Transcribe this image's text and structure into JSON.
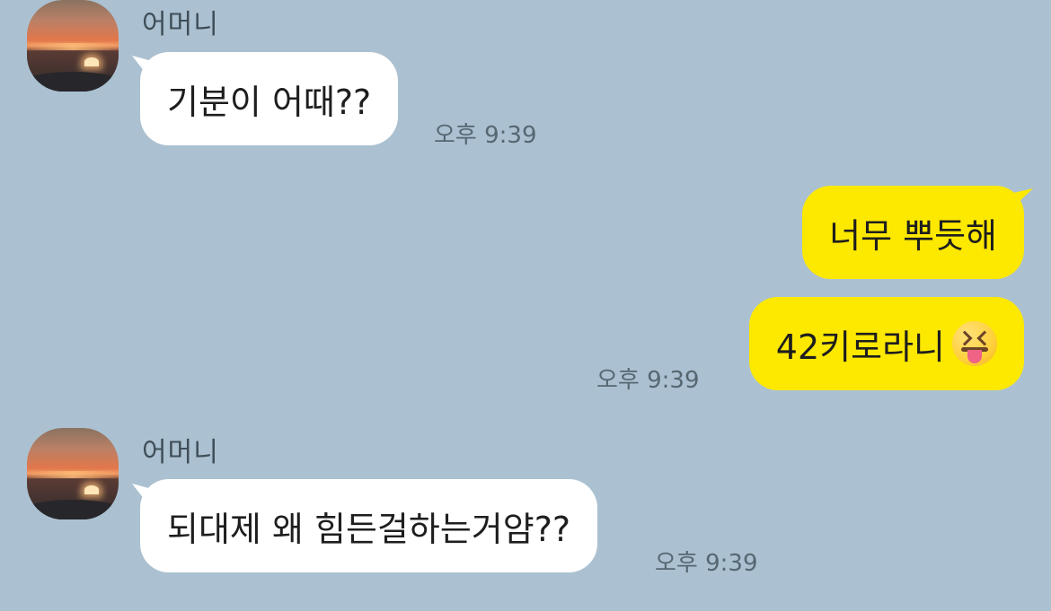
{
  "conversation": {
    "messages": [
      {
        "sender": "어머니",
        "text": "기분이 어때??",
        "time": "오후 9:39"
      },
      {
        "text": "너무 뿌듯해"
      },
      {
        "text": "42키로라니",
        "emoji": "squinting-face-with-tongue-emoji",
        "time": "오후 9:39"
      },
      {
        "sender": "어머니",
        "text": "되대제 왜 힘든걸하는거얌??",
        "time": "오후 9:39"
      }
    ]
  },
  "colors": {
    "background": "#abc1d1",
    "incoming_bubble": "#ffffff",
    "outgoing_bubble": "#fde800"
  }
}
